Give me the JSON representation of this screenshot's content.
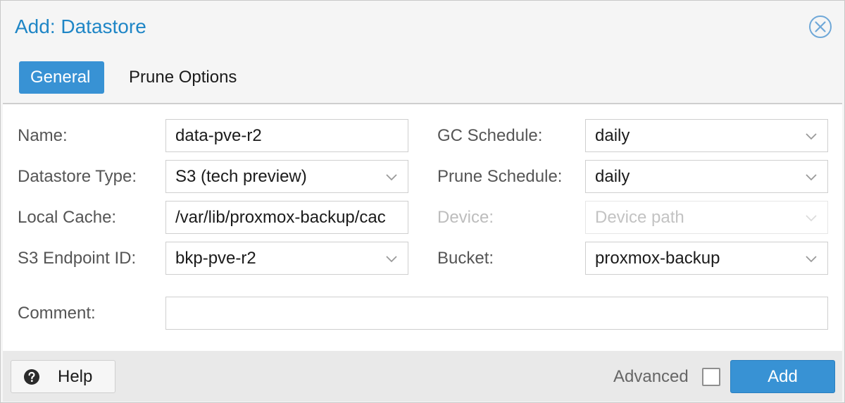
{
  "dialog": {
    "title": "Add: Datastore"
  },
  "tabs": [
    {
      "label": "General",
      "active": true
    },
    {
      "label": "Prune Options",
      "active": false
    }
  ],
  "form": {
    "name": {
      "label": "Name:",
      "value": "data-pve-r2"
    },
    "datastore_type": {
      "label": "Datastore Type:",
      "value": "S3 (tech preview)"
    },
    "local_cache": {
      "label": "Local Cache:",
      "value": "/var/lib/proxmox-backup/cac"
    },
    "s3_endpoint_id": {
      "label": "S3 Endpoint ID:",
      "value": "bkp-pve-r2"
    },
    "gc_schedule": {
      "label": "GC Schedule:",
      "value": "daily"
    },
    "prune_schedule": {
      "label": "Prune Schedule:",
      "value": "daily"
    },
    "device": {
      "label": "Device:",
      "placeholder": "Device path",
      "disabled": true
    },
    "bucket": {
      "label": "Bucket:",
      "value": "proxmox-backup"
    },
    "comment": {
      "label": "Comment:",
      "value": ""
    }
  },
  "footer": {
    "help_label": "Help",
    "advanced_label": "Advanced",
    "advanced_checked": false,
    "add_label": "Add"
  },
  "colors": {
    "accent": "#3892d4",
    "title": "#1f86c6"
  },
  "icons": {
    "close": "close-circle-icon",
    "help": "question-circle-icon",
    "dropdown": "chevron-down-icon"
  }
}
